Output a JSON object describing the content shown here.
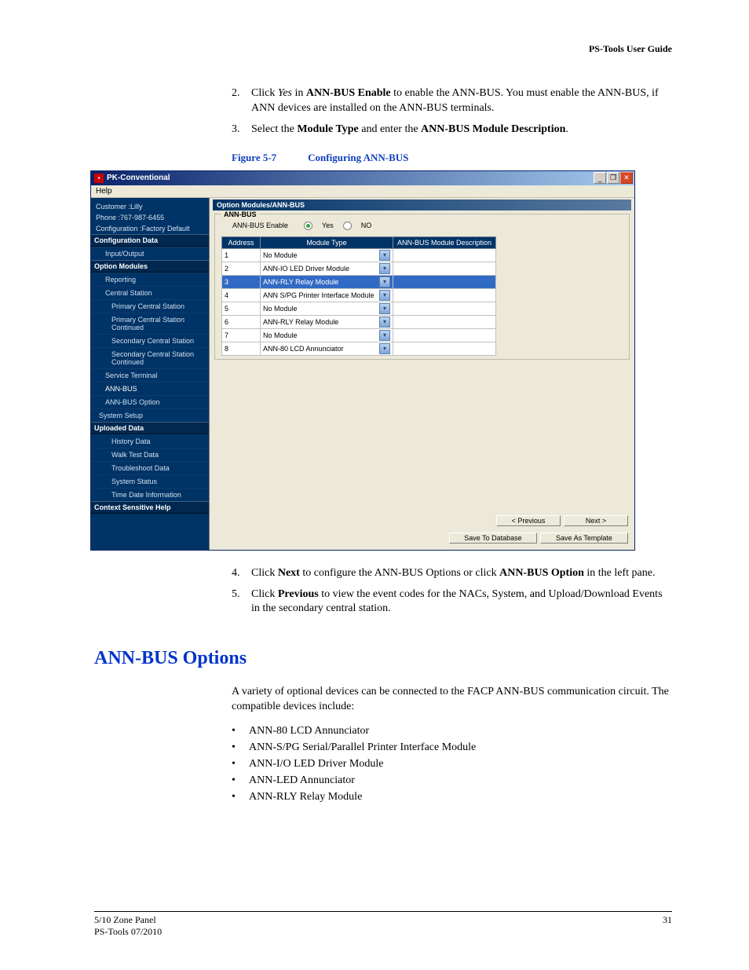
{
  "header": {
    "title": "PS-Tools User Guide"
  },
  "instructions_top": [
    {
      "n": "2.",
      "html": "Click <i>Yes</i> in <b>ANN-BUS Enable</b> to enable the ANN-BUS. You must enable the ANN-BUS, if ANN devices are installed on the ANN-BUS terminals."
    },
    {
      "n": "3.",
      "html": "Select the <b>Module Type</b> and enter the <b>ANN-BUS Module Description</b>."
    }
  ],
  "figure": {
    "label": "Figure 5-7",
    "caption": "Configuring ANN-BUS"
  },
  "window": {
    "title": "PK-Conventional",
    "menu": "Help",
    "side_info": {
      "customer": "Customer :Lilly",
      "phone": "Phone :767-987-6455",
      "config": "Configuration :Factory Default"
    },
    "side_headers": {
      "config_data": "Configuration Data",
      "option_modules": "Option Modules",
      "uploaded_data": "Uploaded Data",
      "ctx_help": "Context Sensitive Help"
    },
    "side_items_config": [
      "Input/Output"
    ],
    "side_items_option": [
      "Reporting",
      "Central Station",
      "Primary Central Station",
      "Primary Central Station Continued",
      "Secondary Central Station",
      "Secondary Central Station Continued",
      "Service Terminal",
      "ANN-BUS",
      "ANN-BUS Option",
      "System Setup"
    ],
    "side_items_uploaded": [
      "History Data",
      "Walk Test Data",
      "Troubleshoot Data",
      "System Status",
      "Time Date Information"
    ],
    "pane_title": "Option Modules/ANN-BUS",
    "fieldset_legend": "ANN-BUS",
    "enable_label": "ANN-BUS Enable",
    "radio_yes": "Yes",
    "radio_no": "NO",
    "grid_headers": {
      "addr": "Address",
      "type": "Module Type",
      "desc": "ANN-BUS Module Description"
    },
    "grid_rows": [
      {
        "addr": "1",
        "type": "No Module",
        "desc": ""
      },
      {
        "addr": "2",
        "type": "ANN-IO LED Driver Module",
        "desc": ""
      },
      {
        "addr": "3",
        "type": "ANN-RLY Relay Module",
        "desc": "",
        "sel": true
      },
      {
        "addr": "4",
        "type": "ANN S/PG Printer Interface Module",
        "desc": ""
      },
      {
        "addr": "5",
        "type": "No Module",
        "desc": ""
      },
      {
        "addr": "6",
        "type": "ANN-RLY Relay Module",
        "desc": ""
      },
      {
        "addr": "7",
        "type": "No Module",
        "desc": ""
      },
      {
        "addr": "8",
        "type": "ANN-80 LCD Annunciator",
        "desc": ""
      }
    ],
    "buttons": {
      "prev": "< Previous",
      "next": "Next >",
      "savedb": "Save To Database",
      "savetpl": "Save As Template"
    }
  },
  "instructions_bottom": [
    {
      "n": "4.",
      "html": "Click <b>Next</b> to configure the ANN-BUS Options or click <b>ANN-BUS Option</b> in the left pane."
    },
    {
      "n": "5.",
      "html": "Click <b>Previous</b> to view the event codes for the NACs, System, and Upload/Download Events in the secondary central station."
    }
  ],
  "section_heading": "ANN-BUS Options",
  "section_intro": "A variety of optional devices can be connected to the FACP ANN-BUS communication circuit. The compatible devices include:",
  "bullets": [
    "ANN-80 LCD Annunciator",
    "ANN-S/PG Serial/Parallel Printer Interface Module",
    "ANN-I/O LED Driver Module",
    "ANN-LED Annunciator",
    "ANN-RLY Relay Module"
  ],
  "footer": {
    "left1": "5/10 Zone Panel",
    "left2": "PS-Tools 07/2010",
    "page": "31"
  }
}
